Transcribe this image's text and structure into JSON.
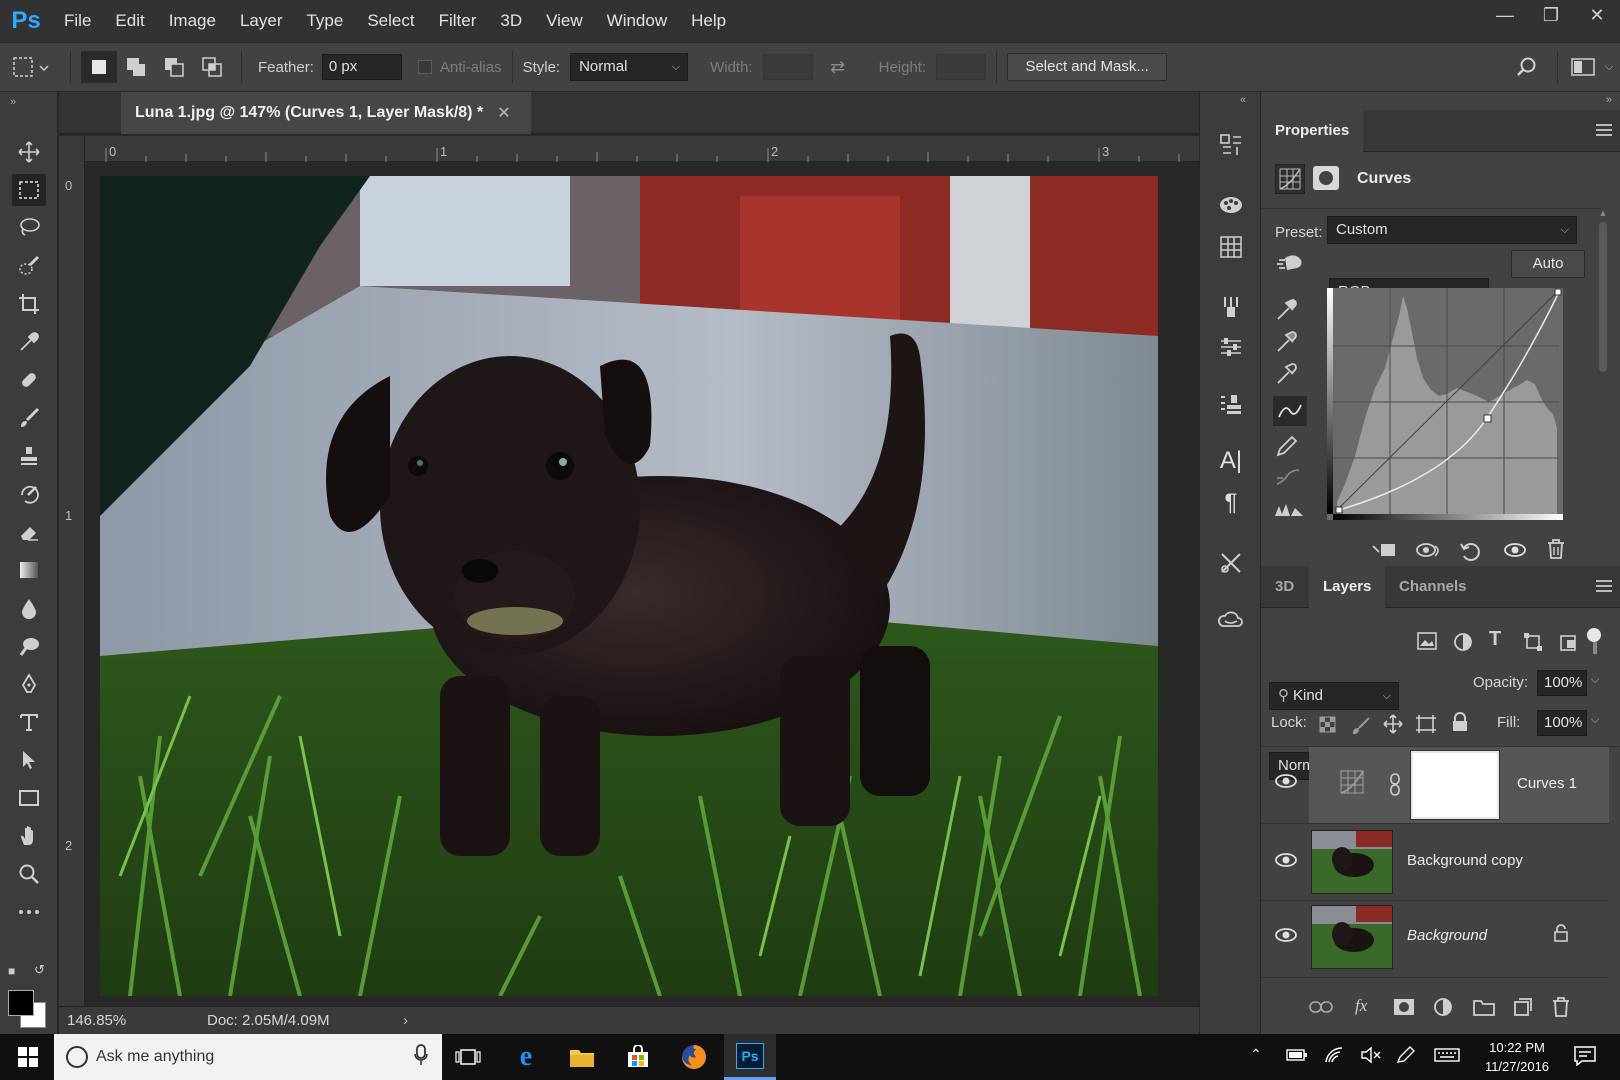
{
  "app": {
    "logo": "Ps"
  },
  "menu": [
    "File",
    "Edit",
    "Image",
    "Layer",
    "Type",
    "Select",
    "Filter",
    "3D",
    "View",
    "Window",
    "Help"
  ],
  "options": {
    "feather_label": "Feather:",
    "feather_value": "0 px",
    "antialias_label": "Anti-alias",
    "style_label": "Style:",
    "style_value": "Normal",
    "width_label": "Width:",
    "height_label": "Height:",
    "select_mask_label": "Select and Mask..."
  },
  "document": {
    "tab_title": "Luna 1.jpg @ 147% (Curves 1, Layer Mask/8) *",
    "zoom": "146.85%",
    "doc_info": "Doc: 2.05M/4.09M",
    "ruler_top": [
      "0",
      "1",
      "2",
      "3"
    ],
    "ruler_left": [
      "0",
      "1",
      "2"
    ]
  },
  "properties": {
    "tab": "Properties",
    "title": "Curves",
    "preset_label": "Preset:",
    "preset_value": "Custom",
    "channel_value": "RGB",
    "auto_label": "Auto"
  },
  "layers_panel": {
    "tabs": [
      "3D",
      "Layers",
      "Channels"
    ],
    "kind_label": "Kind",
    "blend_mode": "Normal",
    "opacity_label": "Opacity:",
    "opacity_value": "100%",
    "lock_label": "Lock:",
    "fill_label": "Fill:",
    "fill_value": "100%",
    "layers": [
      {
        "name": "Curves 1"
      },
      {
        "name": "Background copy"
      },
      {
        "name": "Background"
      }
    ]
  },
  "taskbar": {
    "search_placeholder": "Ask me anything",
    "time": "10:22 PM",
    "date": "11/27/2016",
    "active_app": "Ps"
  },
  "colors": {
    "accent": "#31a8ff",
    "panel_bg": "#424242",
    "canvas_bg": "#282828"
  }
}
